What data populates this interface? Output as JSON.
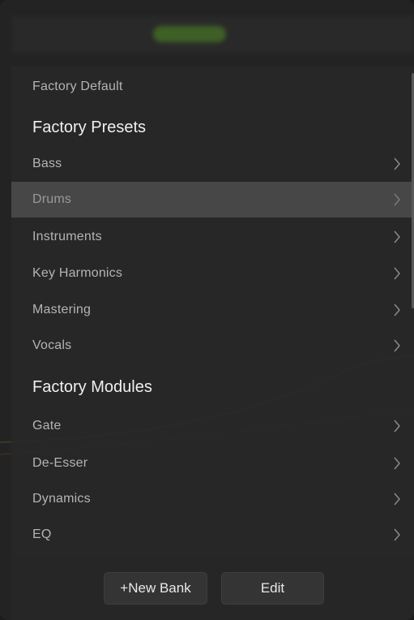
{
  "menu": {
    "factory_default": "Factory Default",
    "presets_header": "Factory Presets",
    "presets": [
      {
        "label": "Bass"
      },
      {
        "label": "Drums"
      },
      {
        "label": "Instruments"
      },
      {
        "label": "Key Harmonics"
      },
      {
        "label": "Mastering"
      },
      {
        "label": "Vocals"
      }
    ],
    "modules_header": "Factory Modules",
    "modules": [
      {
        "label": "Gate"
      },
      {
        "label": "De-Esser"
      },
      {
        "label": "Dynamics"
      },
      {
        "label": "EQ"
      }
    ],
    "selected_item": "Drums"
  },
  "footer": {
    "new_bank_label": "+New Bank",
    "edit_label": "Edit"
  },
  "icons": {
    "submenu": "chevron-right-icon"
  },
  "colors": {
    "menu_bg": "#282828",
    "selected_bg": "#474747",
    "section_text": "#f0f0f0",
    "item_text": "#b4b4b4"
  }
}
